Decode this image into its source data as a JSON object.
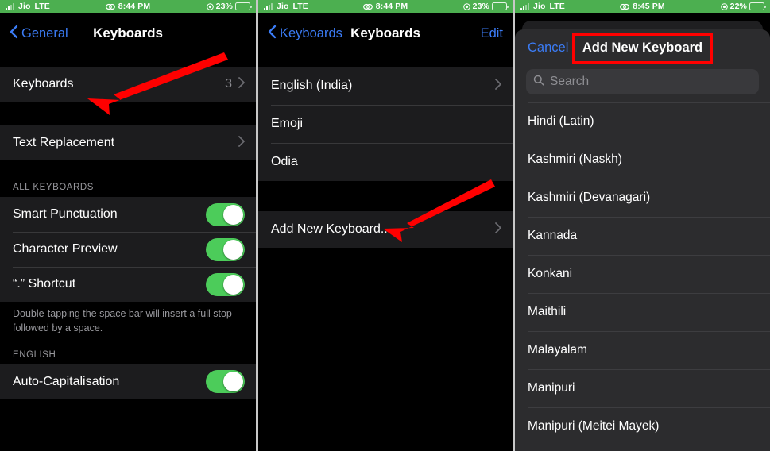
{
  "accent": {
    "blue": "#3b7cf6",
    "green_toggle": "#4ccc5a",
    "status_green": "#4caf50",
    "annotation_red": "#ff0000"
  },
  "panel1": {
    "status": {
      "carrier": "Jio",
      "network": "LTE",
      "time": "8:44 PM",
      "battery_pct": "23%",
      "signal_icon": "signal-bars-icon",
      "link_icon": "chain-link-icon",
      "location_icon": "location-services-icon",
      "battery_icon": "battery-icon"
    },
    "nav": {
      "back_label": "General",
      "title": "Keyboards",
      "back_icon": "chevron-left-icon"
    },
    "rows": [
      {
        "label": "Keyboards",
        "value": "3",
        "disclosure": "chevron-right-icon"
      }
    ],
    "rows2": [
      {
        "label": "Text Replacement",
        "value": "",
        "disclosure": "chevron-right-icon"
      }
    ],
    "section_all": "ALL KEYBOARDS",
    "toggles": [
      {
        "label": "Smart Punctuation",
        "on": true
      },
      {
        "label": "Character Preview",
        "on": true
      },
      {
        "label": "“.” Shortcut",
        "on": true
      }
    ],
    "footnote": "Double-tapping the space bar will insert a full stop followed by a space.",
    "section_english": "ENGLISH",
    "toggles2": [
      {
        "label": "Auto-Capitalisation",
        "on": true
      }
    ],
    "annotation": {
      "name": "red-arrow-pointing-to-keyboards-row"
    }
  },
  "panel2": {
    "status": {
      "carrier": "Jio",
      "network": "LTE",
      "time": "8:44 PM",
      "battery_pct": "23%",
      "signal_icon": "signal-bars-icon",
      "link_icon": "chain-link-icon",
      "location_icon": "location-services-icon",
      "battery_icon": "battery-icon"
    },
    "nav": {
      "back_label": "Keyboards",
      "title": "Keyboards",
      "edit_label": "Edit",
      "back_icon": "chevron-left-icon"
    },
    "keyboards": [
      {
        "label": "English (India)",
        "disclosure": "chevron-right-icon"
      },
      {
        "label": "Emoji",
        "disclosure": ""
      },
      {
        "label": "Odia",
        "disclosure": ""
      }
    ],
    "add_row": {
      "label": "Add New Keyboard...",
      "disclosure": "chevron-right-icon"
    },
    "annotation": {
      "name": "red-arrow-pointing-to-add-new-keyboard-row"
    }
  },
  "panel3": {
    "status": {
      "carrier": "Jio",
      "network": "LTE",
      "time": "8:45 PM",
      "battery_pct": "22%",
      "signal_icon": "signal-bars-icon",
      "link_icon": "chain-link-icon",
      "location_icon": "location-services-icon",
      "battery_icon": "battery-icon"
    },
    "sheet": {
      "cancel_label": "Cancel",
      "title": "Add New Keyboard",
      "highlighted": true
    },
    "search": {
      "placeholder": "Search",
      "value": "",
      "icon": "search-icon"
    },
    "languages": [
      "Hindi (Latin)",
      "Kashmiri (Naskh)",
      "Kashmiri (Devanagari)",
      "Kannada",
      "Konkani",
      "Maithili",
      "Malayalam",
      "Manipuri",
      "Manipuri (Meitei Mayek)"
    ]
  }
}
